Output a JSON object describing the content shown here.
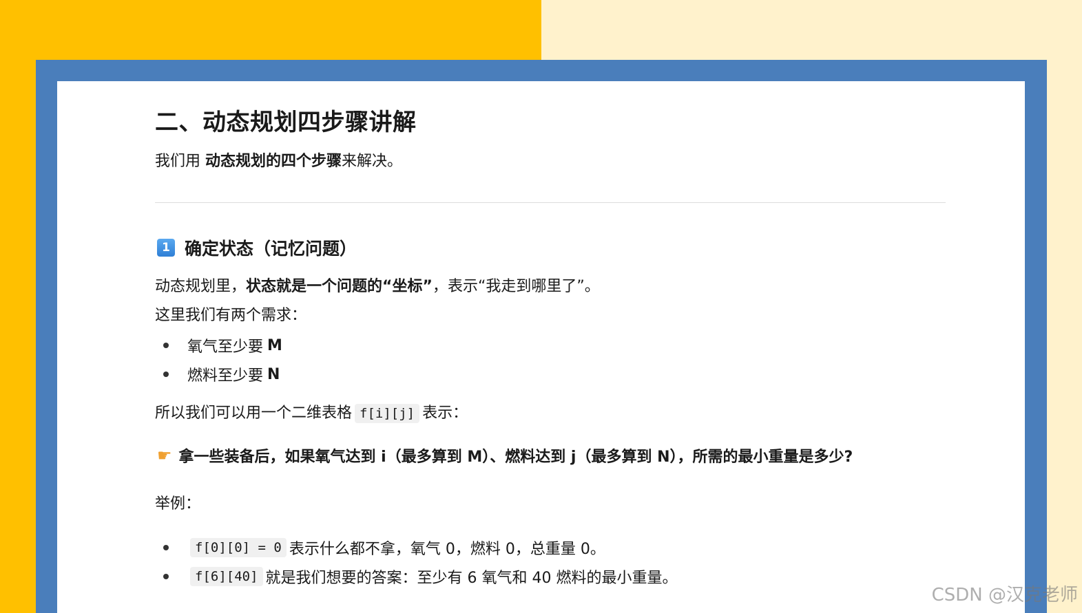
{
  "heading": "二、动态规划四步骤讲解",
  "intro": {
    "pre": "我们用 ",
    "bold": "动态规划的四个步骤",
    "post": "来解决。"
  },
  "step1": {
    "badge": "1",
    "title": "确定状态（记忆问题）",
    "line1": {
      "pre": "动态规划里，",
      "bold": "状态就是一个问题的“坐标”",
      "post": "，表示“我走到哪里了”。"
    },
    "line2": "这里我们有两个需求：",
    "needs": [
      {
        "text": "氧气至少要 ",
        "bold": "M"
      },
      {
        "text": "燃料至少要 ",
        "bold": "N"
      }
    ],
    "line3": {
      "pre": "所以我们可以用一个二维表格",
      "code": "f[i][j]",
      "post": "表示："
    },
    "point": "拿一些装备后，如果氧气达到 i（最多算到 M）、燃料达到 j（最多算到 N），所需的最小重量是多少?",
    "example_label": "举例：",
    "examples": [
      {
        "code": "f[0][0] = 0",
        "text": "表示什么都不拿，氧气 0，燃料 0，总重量 0。"
      },
      {
        "code": "f[6][40]",
        "text": "就是我们想要的答案：至少有 6 氧气和 40 燃料的最小重量。"
      }
    ]
  },
  "watermark": "CSDN @汉克老师"
}
